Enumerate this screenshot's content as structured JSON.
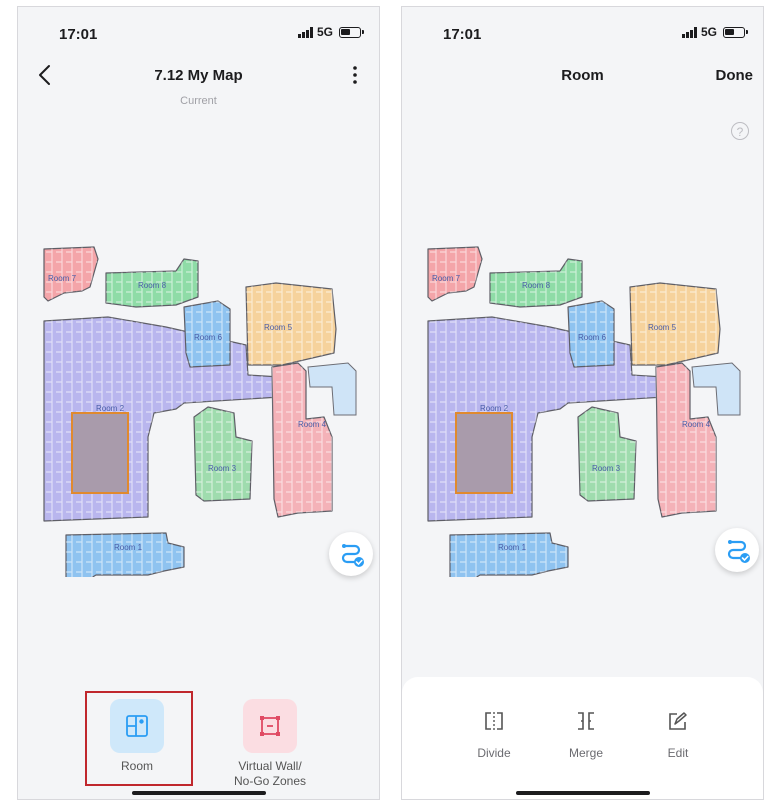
{
  "screens": [
    {
      "status": {
        "time": "17:01",
        "network": "5G"
      },
      "header": {
        "title": "7.12 My Map",
        "subtitle": "Current"
      },
      "tools": [
        {
          "label": "Room",
          "icon": "room-map-icon"
        },
        {
          "label": "Virtual Wall/\nNo-Go Zones",
          "icon": "virtual-wall-icon"
        }
      ]
    },
    {
      "status": {
        "time": "17:01",
        "network": "5G"
      },
      "header": {
        "title": "Room",
        "done_label": "Done",
        "help_label": "?"
      },
      "actions": [
        {
          "label": "Divide",
          "icon": "divide-icon"
        },
        {
          "label": "Merge",
          "icon": "merge-icon"
        },
        {
          "label": "Edit",
          "icon": "edit-icon"
        }
      ]
    }
  ],
  "map": {
    "rooms": [
      {
        "label": "Room 1",
        "color": "#8fc3f0"
      },
      {
        "label": "Room 2",
        "color": "#b9b6ee"
      },
      {
        "label": "Room 3",
        "color": "#9fdcae"
      },
      {
        "label": "Room 4",
        "color": "#f4b2b8"
      },
      {
        "label": "Room 5",
        "color": "#f6d29c"
      },
      {
        "label": "Room 6",
        "color": "#8fc3f0"
      },
      {
        "label": "Room 7",
        "color": "#f4a5a9"
      },
      {
        "label": "Room 8",
        "color": "#8fdca7"
      }
    ]
  },
  "colors": {
    "accent": "#2a9df4",
    "highlight": "#c0272d",
    "no_go_zone": "#e08a2e"
  }
}
